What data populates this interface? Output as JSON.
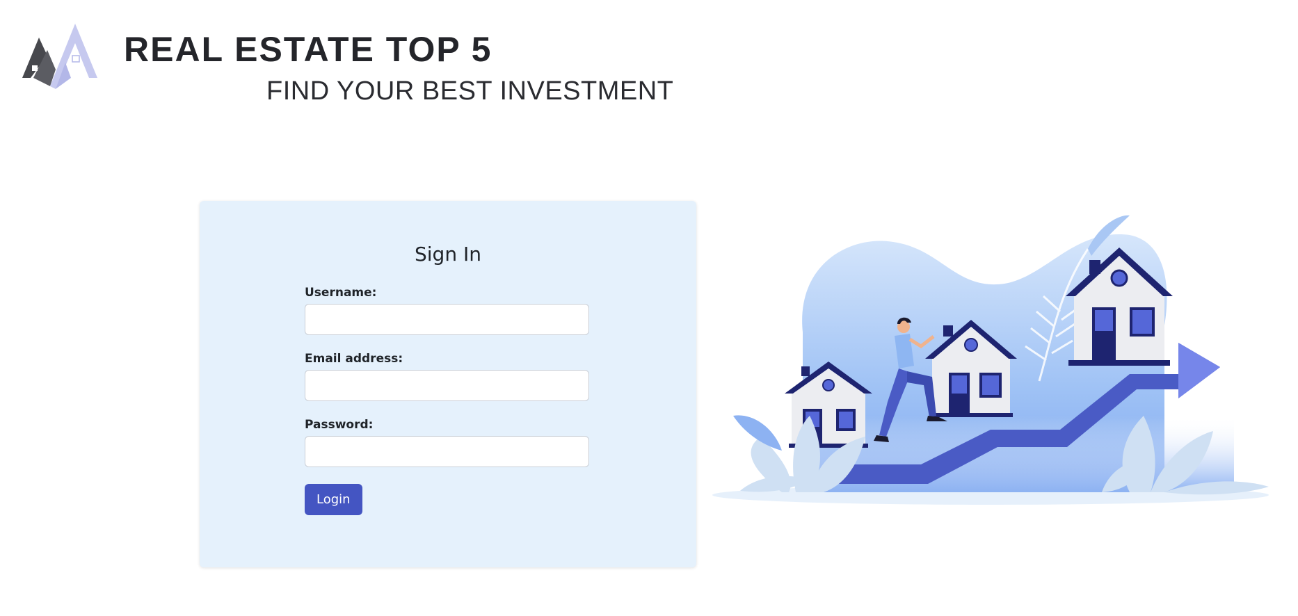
{
  "header": {
    "title": "REAL ESTATE TOP 5",
    "tagline": "FIND YOUR BEST INVESTMENT",
    "logo_icon": "house-roof-logo"
  },
  "signin": {
    "heading": "Sign In",
    "username_label": "Username:",
    "username_value": "",
    "email_label": "Email address:",
    "email_value": "",
    "password_label": "Password:",
    "password_value": "",
    "login_label": "Login"
  },
  "hero": {
    "illustration": "man-climbing-arrow-with-houses-illustration"
  },
  "colors": {
    "accent": "#4455c2",
    "card_bg": "#e5f1fc",
    "title_text": "#24252a",
    "house_navy": "#1e2470",
    "arrow": "#6b7ee8"
  }
}
